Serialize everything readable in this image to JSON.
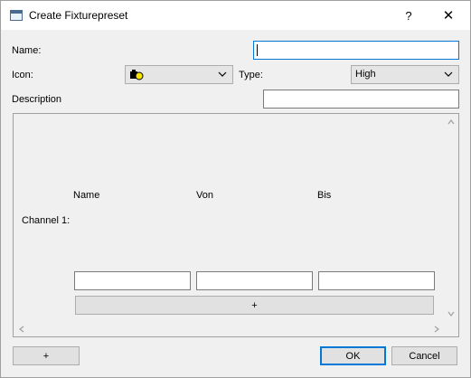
{
  "window": {
    "title": "Create Fixturepreset",
    "help_glyph": "?",
    "close_glyph": "✕"
  },
  "form": {
    "name_label": "Name:",
    "name_value": "",
    "icon_label": "Icon:",
    "icon_value": "bulb-icon",
    "type_label": "Type:",
    "type_value": "High",
    "description_label": "Description",
    "description_value": ""
  },
  "channels": {
    "col_name": "Name",
    "col_von": "Von",
    "col_bis": "Bis",
    "rows": [
      {
        "label": "Channel 1:",
        "name": "",
        "von": "",
        "bis": ""
      }
    ],
    "add_channel_label": "+"
  },
  "footer": {
    "add_label": "+",
    "ok_label": "OK",
    "cancel_label": "Cancel"
  },
  "colors": {
    "accent": "#0078d7",
    "bulb_yellow": "#f5e500"
  }
}
